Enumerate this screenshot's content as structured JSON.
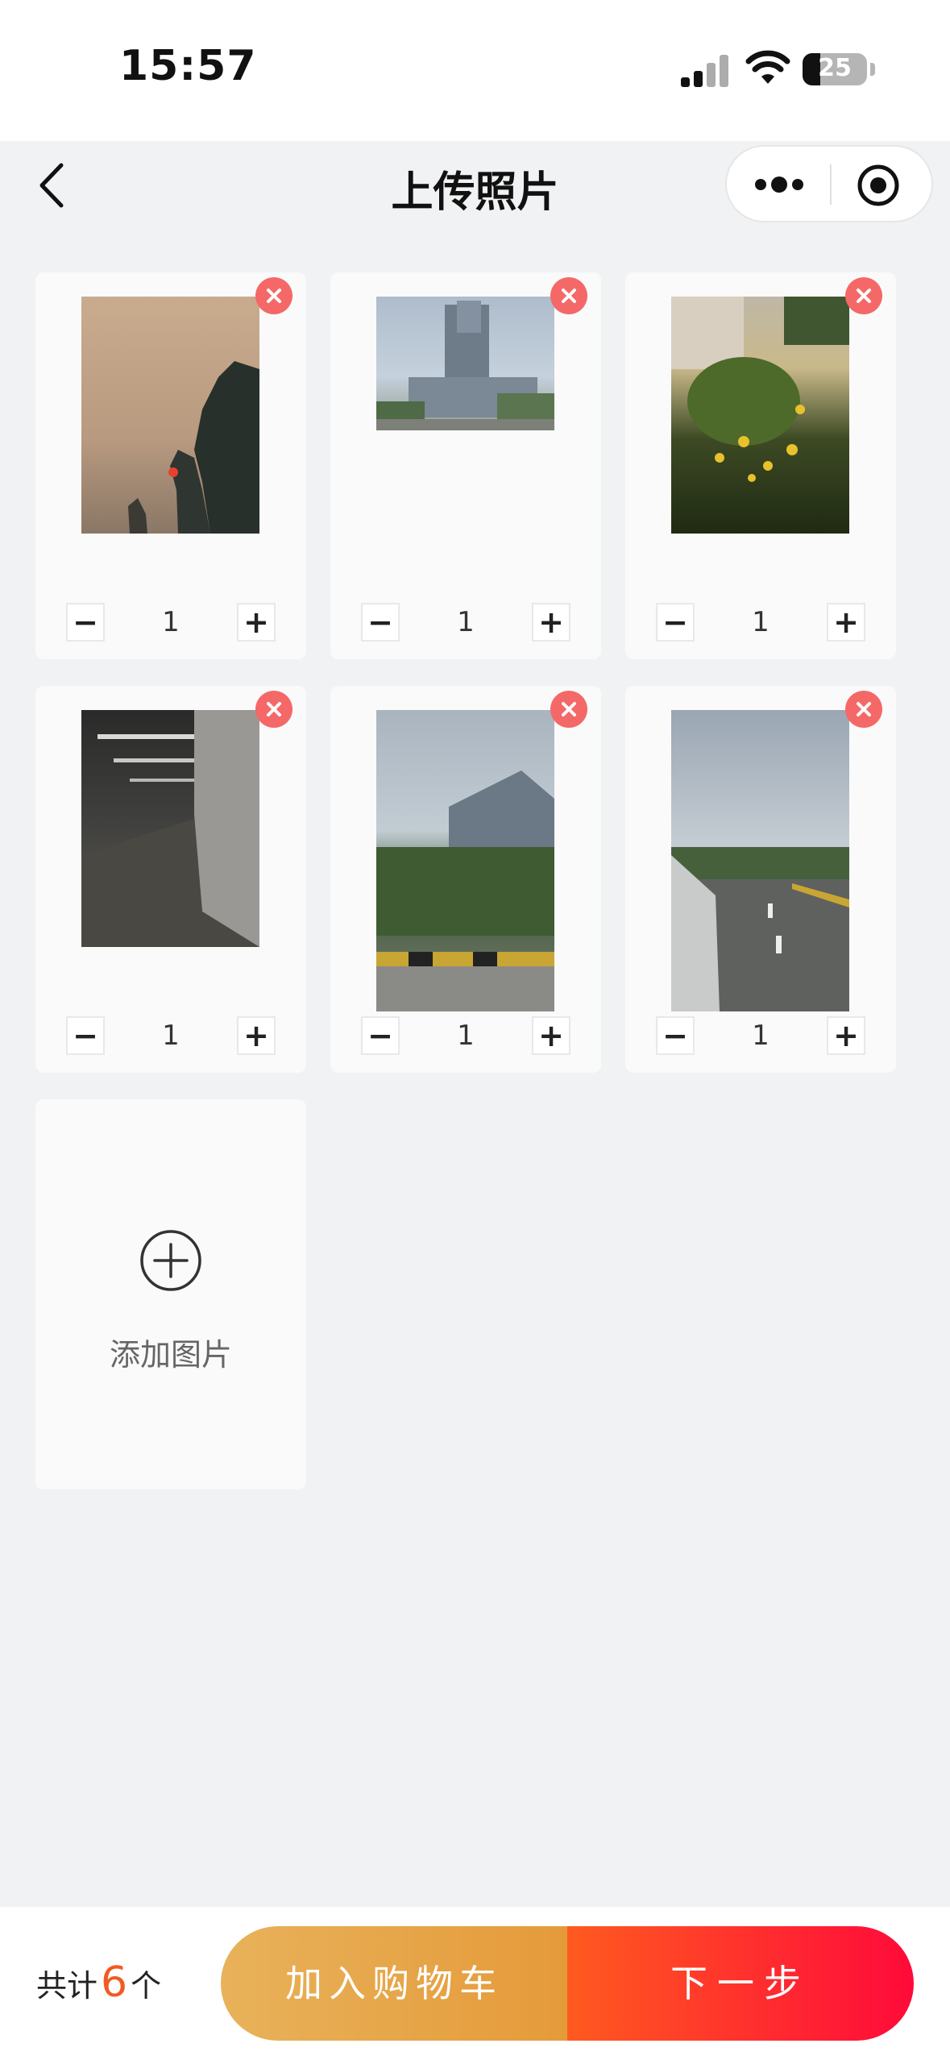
{
  "status_bar": {
    "time": "15:57",
    "battery": "25"
  },
  "nav": {
    "title": "上传照片"
  },
  "photos": [
    {
      "quantity": "1",
      "minus": "−",
      "plus": "+"
    },
    {
      "quantity": "1",
      "minus": "−",
      "plus": "+"
    },
    {
      "quantity": "1",
      "minus": "−",
      "plus": "+"
    },
    {
      "quantity": "1",
      "minus": "−",
      "plus": "+"
    },
    {
      "quantity": "1",
      "minus": "−",
      "plus": "+"
    },
    {
      "quantity": "1",
      "minus": "−",
      "plus": "+"
    }
  ],
  "add": {
    "label": "添加图片"
  },
  "footer": {
    "total_prefix": "共计",
    "total_count": "6",
    "total_suffix": "个",
    "cart_button": "加入购物车",
    "next_button": "下一步"
  },
  "colors": {
    "remove_badge": "#f56868",
    "accent": "#f15a24",
    "cart_gradient": [
      "#e8b25a",
      "#e59a3a"
    ],
    "next_gradient": [
      "#ff5a1f",
      "#ff0a3a"
    ]
  }
}
